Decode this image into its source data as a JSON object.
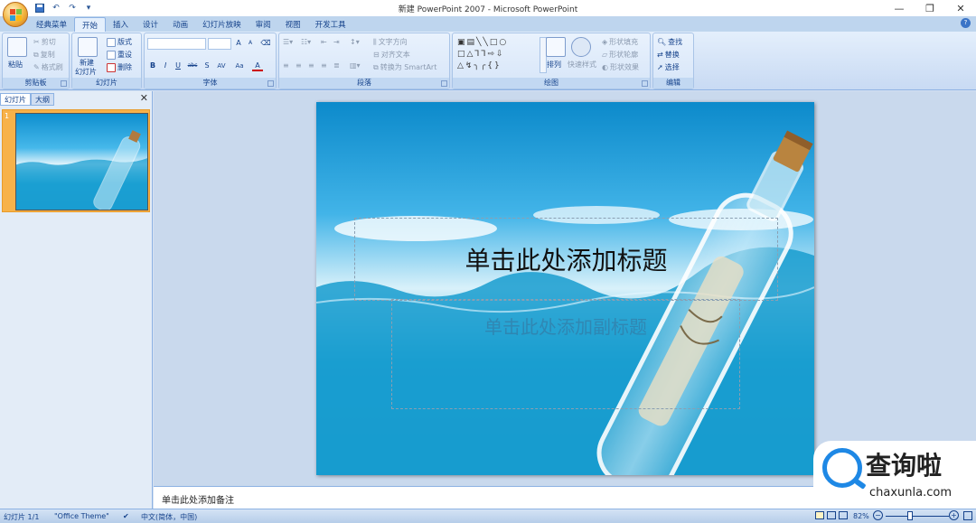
{
  "titlebar": {
    "title": "新建 PowerPoint 2007 - Microsoft PowerPoint",
    "qat": [
      "save-icon",
      "undo-icon",
      "redo-icon",
      "customize-icon"
    ],
    "controls": {
      "minimize": "—",
      "restore": "❐",
      "close": "✕"
    }
  },
  "tabs": [
    "经典菜单",
    "开始",
    "插入",
    "设计",
    "动画",
    "幻灯片放映",
    "审阅",
    "视图",
    "开发工具"
  ],
  "active_tab": "开始",
  "ribbon": {
    "clipboard": {
      "title": "剪贴板",
      "paste": "粘贴",
      "cut": "剪切",
      "copy": "复制",
      "format_painter": "格式刷"
    },
    "slides": {
      "title": "幻灯片",
      "new_slide": "新建",
      "new_slide2": "幻灯片",
      "layout": "版式",
      "reset": "重设",
      "delete": "删除"
    },
    "font": {
      "title": "字体",
      "bold": "B",
      "italic": "I",
      "underline": "U",
      "strike": "abc",
      "shadow": "S",
      "spacing": "AV",
      "case": "Aa",
      "color": "A",
      "grow": "A",
      "shrink": "A"
    },
    "paragraph": {
      "title": "段落",
      "text_direction": "文字方向",
      "align_text": "对齐文本",
      "smartart": "转换为 SmartArt"
    },
    "drawing": {
      "title": "绘图",
      "arrange": "排列",
      "quick_styles": "快速样式",
      "shape_fill": "形状填充",
      "shape_outline": "形状轮廓",
      "shape_effects": "形状效果"
    },
    "editing": {
      "title": "编辑",
      "find": "查找",
      "replace": "替换",
      "select": "选择"
    }
  },
  "panel": {
    "tabs": [
      "幻灯片",
      "大纲"
    ],
    "close": "✕",
    "thumb_number": "1"
  },
  "slide": {
    "title_placeholder": "单击此处添加标题",
    "subtitle_placeholder": "单击此处添加副标题"
  },
  "notes": {
    "placeholder": "单击此处添加备注"
  },
  "watermark": {
    "title": "查询啦",
    "url": "chaxunla.com"
  },
  "status": {
    "slide_info": "幻灯片 1/1",
    "theme": "\"Office Theme\"",
    "language": "中文(简体，中国)",
    "zoom": "82%",
    "zoom_minus": "−",
    "zoom_plus": "+"
  }
}
